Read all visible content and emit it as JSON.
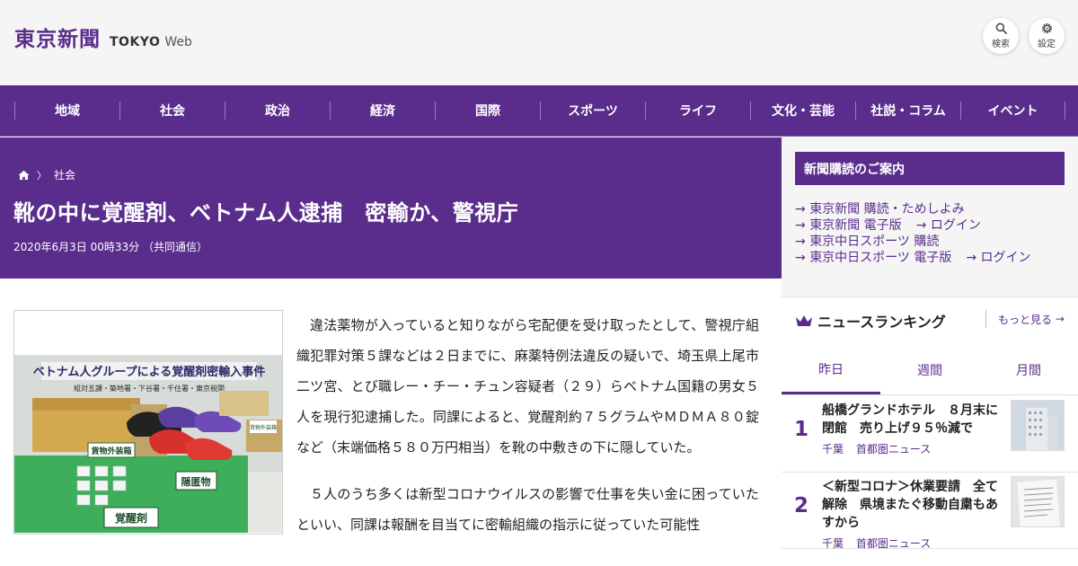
{
  "header": {
    "logo_kanji": "東京新聞",
    "logo_tokyo": "TOKYO",
    "logo_web": "Web",
    "search_label": "検索",
    "settings_label": "設定"
  },
  "nav": {
    "items": [
      "地域",
      "社会",
      "政治",
      "経済",
      "国際",
      "スポーツ",
      "ライフ",
      "文化・芸能",
      "社説・コラム",
      "イベント"
    ]
  },
  "article": {
    "breadcrumb_section": "社会",
    "title": "靴の中に覚醒剤、ベトナム人逮捕　密輸か、警視庁",
    "meta": "2020年6月3日 00時33分 （共同通信）",
    "photo_texts": {
      "banner": "ベトナム人グループによる覚醒剤密輸入事件",
      "sub": "組対五課・築地署・下谷署・千住署・東京税関",
      "package": "貨物外装箱",
      "drug": "覚醒剤",
      "hidden": "隠匿物",
      "outer_right": "貨物外装箱"
    },
    "paragraphs": [
      "違法薬物が入っていると知りながら宅配便を受け取ったとして、警視庁組織犯罪対策５課などは２日までに、麻薬特例法違反の疑いで、埼玉県上尾市二ツ宮、とび職レー・チー・チュン容疑者（２９）らベトナム国籍の男女５人を現行犯逮捕した。同課によると、覚醒剤約７５グラムやＭＤＭＡ８０錠など（末端価格５８０万円相当）を靴の中敷きの下に隠していた。",
      "５人のうち多くは新型コロナウイルスの影響で仕事を失い金に困っていたといい、同課は報酬を目当てに密輸組織の指示に従っていた可能性"
    ]
  },
  "subscription": {
    "title": "新聞購読のご案内",
    "rows": [
      [
        "東京新聞 購読・ためしよみ"
      ],
      [
        "東京新聞 電子版",
        "ログイン"
      ],
      [
        "東京中日スポーツ 購読"
      ],
      [
        "東京中日スポーツ 電子版",
        "ログイン"
      ]
    ]
  },
  "ranking": {
    "title": "ニュースランキング",
    "more_label": "もっと見る",
    "tabs": [
      "昨日",
      "週間",
      "月間"
    ],
    "active_tab": "昨日",
    "items": [
      {
        "rank": "1",
        "title": "船橋グランドホテル　８月末に閉館　売り上げ９５％減で",
        "tags": [
          "千葉",
          "首都圏ニュース"
        ]
      },
      {
        "rank": "2",
        "title": "＜新型コロナ＞休業要請　全て解除　県境またぐ移動自粛もあすから",
        "tags": [
          "千葉",
          "首都圏ニュース"
        ]
      }
    ]
  },
  "colors": {
    "brand": "#5a2d8c",
    "background": "#f5f5f5"
  },
  "icons": [
    "search-icon",
    "gear-icon",
    "home-icon",
    "crown-icon",
    "arrow-right-icon"
  ]
}
